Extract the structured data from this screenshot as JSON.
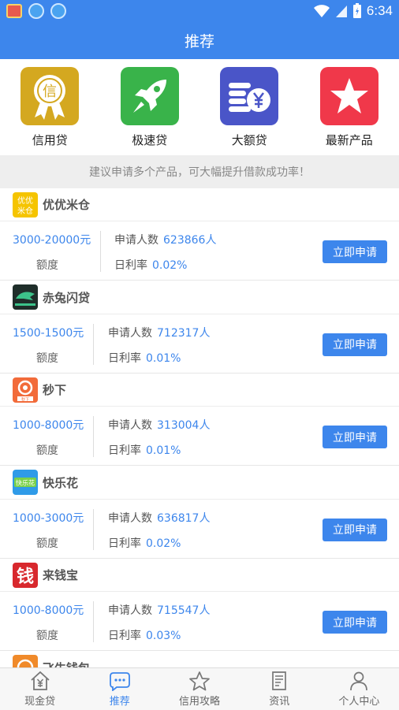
{
  "status": {
    "time": "6:34"
  },
  "header": {
    "title": "推荐"
  },
  "categories": [
    {
      "label": "信用贷",
      "icon": "credit-badge-icon",
      "color": "#d4a820"
    },
    {
      "label": "极速贷",
      "icon": "rocket-icon",
      "color": "#39b34a"
    },
    {
      "label": "大额贷",
      "icon": "coins-yen-icon",
      "color": "#4a55c8"
    },
    {
      "label": "最新产品",
      "icon": "star-icon",
      "color": "#f0384a"
    }
  ],
  "category_badge_char": "信",
  "tip": "建议申请多个产品，可大幅提升借款成功率！",
  "labels": {
    "amount": "额度",
    "applicants": "申请人数",
    "rate": "日利率",
    "apply": "立即申请"
  },
  "products": [
    {
      "name": "优优米仓",
      "amount": "3000-20000元",
      "applicants": "623866人",
      "rate": "0.02%",
      "logo_text": "优优米仓"
    },
    {
      "name": "赤兔闪贷",
      "amount": "1500-1500元",
      "applicants": "712317人",
      "rate": "0.01%"
    },
    {
      "name": "秒下",
      "amount": "1000-8000元",
      "applicants": "313004人",
      "rate": "0.01%",
      "logo_text": "秒下"
    },
    {
      "name": "快乐花",
      "amount": "1000-3000元",
      "applicants": "636817人",
      "rate": "0.02%",
      "logo_text": "快乐花"
    },
    {
      "name": "来钱宝",
      "amount": "1000-8000元",
      "applicants": "715547人",
      "rate": "0.03%",
      "logo_text": "钱"
    },
    {
      "name": "飞牛钱包"
    }
  ],
  "tabs": [
    {
      "label": "现金贷",
      "icon": "house-yen-icon"
    },
    {
      "label": "推荐",
      "icon": "chat-bubble-icon",
      "active": true
    },
    {
      "label": "信用攻略",
      "icon": "star-outline-icon"
    },
    {
      "label": "资讯",
      "icon": "document-icon"
    },
    {
      "label": "个人中心",
      "icon": "person-icon"
    }
  ],
  "colors": {
    "primary": "#3d86ec",
    "tab_inactive": "#666666"
  }
}
